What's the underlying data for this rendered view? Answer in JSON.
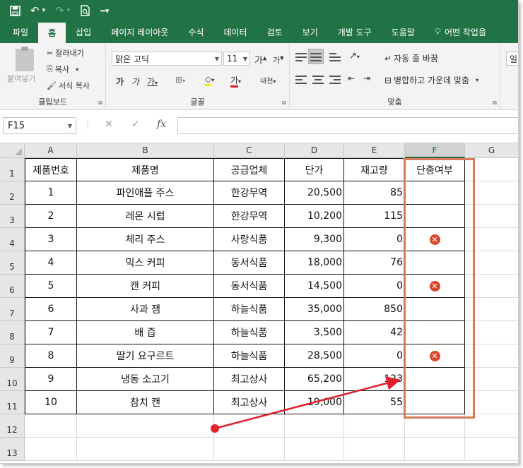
{
  "qat": {
    "save_icon": "save-icon",
    "undo_icon": "undo-icon",
    "redo_icon": "redo-icon",
    "print_preview_icon": "print-preview-icon",
    "customize_icon": "customize-qat-icon"
  },
  "tabs": [
    {
      "label": "파일"
    },
    {
      "label": "홈"
    },
    {
      "label": "삽입"
    },
    {
      "label": "페이지 레이아웃"
    },
    {
      "label": "수식"
    },
    {
      "label": "데이터"
    },
    {
      "label": "검토"
    },
    {
      "label": "보기"
    },
    {
      "label": "개발 도구"
    },
    {
      "label": "도움말"
    },
    {
      "label": "어떤 작업을"
    }
  ],
  "ribbon": {
    "clipboard": {
      "label": "클립보드",
      "paste": "붙여넣기",
      "cut": "잘라내기",
      "copy": "복사",
      "format_painter": "서식 복사"
    },
    "font": {
      "label": "글꼴",
      "font_name": "맑은 고딕",
      "font_size": "11",
      "bold": "가",
      "italic": "가",
      "underline": "가",
      "font_color": "가",
      "phonetic": "내천"
    },
    "alignment": {
      "label": "맞춤",
      "wrap_text": "자동 줄 바꿈",
      "merge_center": "병합하고 가운데 맞춤"
    },
    "extra": "일"
  },
  "formula_bar": {
    "name_box": "F15",
    "fx": "fx",
    "formula": ""
  },
  "columns": [
    "A",
    "B",
    "C",
    "D",
    "E",
    "F",
    "G"
  ],
  "selected_column": "F",
  "rows": [
    "1",
    "2",
    "3",
    "4",
    "5",
    "6",
    "7",
    "8",
    "9",
    "10",
    "11",
    "12",
    "13"
  ],
  "table": {
    "headers": [
      "제품번호",
      "제품명",
      "공급업체",
      "단가",
      "재고량",
      "단종여부"
    ],
    "data": [
      {
        "no": "1",
        "name": "파인애플 주스",
        "supplier": "한강무역",
        "price": "20,500",
        "stock": "85",
        "discontinued": false
      },
      {
        "no": "2",
        "name": "레몬 시럽",
        "supplier": "한강무역",
        "price": "10,200",
        "stock": "115",
        "discontinued": false
      },
      {
        "no": "3",
        "name": "체리 주스",
        "supplier": "사랑식품",
        "price": "9,300",
        "stock": "0",
        "discontinued": true
      },
      {
        "no": "4",
        "name": "믹스 커피",
        "supplier": "동서식품",
        "price": "18,000",
        "stock": "76",
        "discontinued": false
      },
      {
        "no": "5",
        "name": "캔 커피",
        "supplier": "동서식품",
        "price": "14,500",
        "stock": "0",
        "discontinued": true
      },
      {
        "no": "6",
        "name": "사과 잼",
        "supplier": "하늘식품",
        "price": "35,000",
        "stock": "850",
        "discontinued": false
      },
      {
        "no": "7",
        "name": "배 즙",
        "supplier": "하늘식품",
        "price": "3,500",
        "stock": "42",
        "discontinued": false
      },
      {
        "no": "8",
        "name": "딸기 요구르트",
        "supplier": "하늘식품",
        "price": "28,500",
        "stock": "0",
        "discontinued": true
      },
      {
        "no": "9",
        "name": "냉동 소고기",
        "supplier": "최고상사",
        "price": "65,200",
        "stock": "123",
        "discontinued": false
      },
      {
        "no": "10",
        "name": "참치 캔",
        "supplier": "최고상사",
        "price": "19,000",
        "stock": "55",
        "discontinued": false
      }
    ]
  },
  "colors": {
    "excel_green": "#217346",
    "highlight_box": "#d9785a",
    "arrow": "#e0202a",
    "discontinued_mark": "#d9462b"
  }
}
